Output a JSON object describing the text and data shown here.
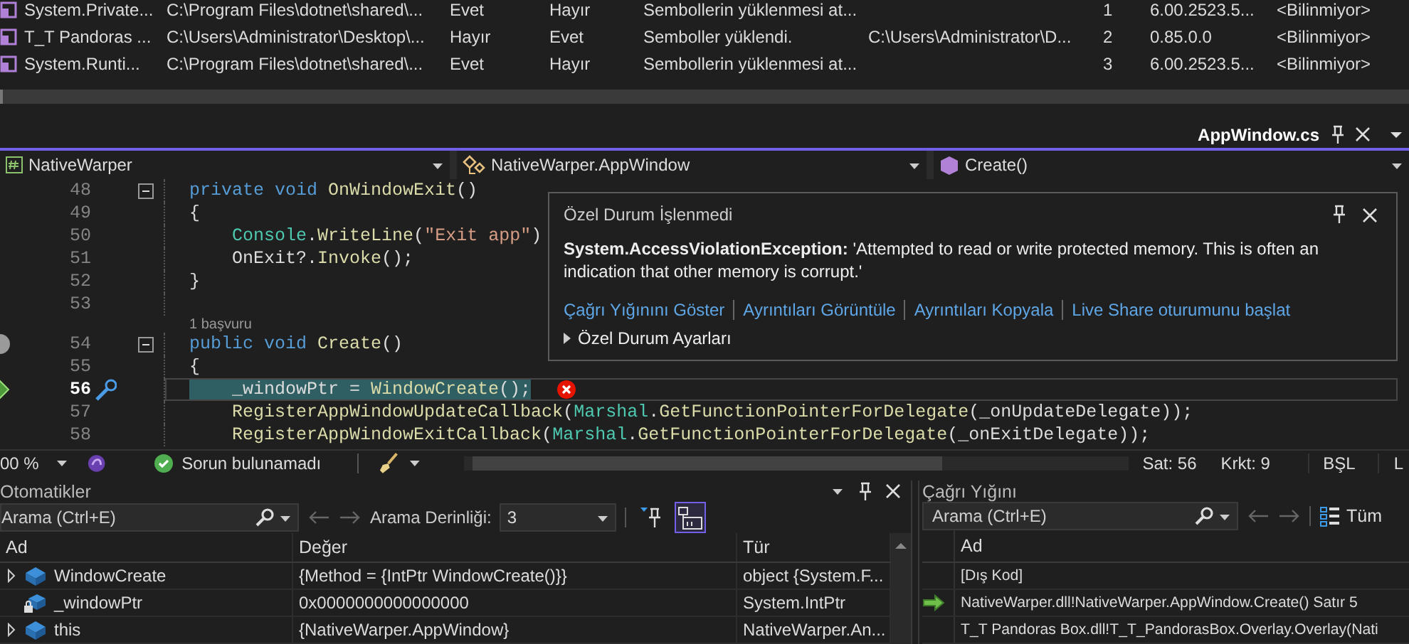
{
  "modules": {
    "rows": [
      {
        "column_1": "System.Private...",
        "column_2": "C:\\Program Files\\dotnet\\shared\\...",
        "column_3": "Evet",
        "column_4": "Hayır",
        "column_5": "Sembollerin yüklenmesi at...",
        "column_7": "1",
        "column_8": "6.00.2523.5...",
        "column_9": "<Bilinmiyor>"
      },
      {
        "column_1": "T_T Pandoras ...",
        "column_2": "C:\\Users\\Administrator\\Desktop\\...",
        "column_3": "Hayır",
        "column_4": "Evet",
        "column_5": "Semboller yüklendi.",
        "column_6": "C:\\Users\\Administrator\\D...",
        "column_7": "2",
        "column_8": "0.85.0.0",
        "column_9": "<Bilinmiyor>"
      },
      {
        "column_1": "System.Runti...",
        "column_2": "C:\\Program Files\\dotnet\\shared\\...",
        "column_3": "Evet",
        "column_4": "Hayır",
        "column_5": "Sembollerin yüklenmesi at...",
        "column_7": "3",
        "column_8": "6.00.2523.5...",
        "column_9": "<Bilinmiyor>"
      }
    ]
  },
  "doc_tabs": [
    {
      "label": "AppWindow.cs",
      "selected": true
    }
  ],
  "navigation": [
    {
      "kind": "project",
      "label": "NativeWarper"
    },
    {
      "kind": "class",
      "label": "NativeWarper.AppWindow"
    },
    {
      "kind": "method",
      "label": "Create()"
    }
  ],
  "editor": {
    "lines": [
      {
        "kind": "code",
        "number": "48",
        "foldable": true,
        "breakpoint": false,
        "current": false,
        "error": false,
        "tokens": [
          {
            "kind": "keyword",
            "text": "private void "
          },
          {
            "kind": "method",
            "text": "OnWindowExit"
          },
          {
            "kind": "plain",
            "text": "()"
          }
        ]
      },
      {
        "kind": "code",
        "number": "49",
        "foldable": false,
        "breakpoint": false,
        "current": false,
        "error": false,
        "tokens": [
          {
            "kind": "plain",
            "text": "{"
          }
        ]
      },
      {
        "kind": "code",
        "number": "50",
        "foldable": false,
        "breakpoint": false,
        "current": false,
        "error": false,
        "tokens": [
          {
            "kind": "type",
            "text": "    Console"
          },
          {
            "kind": "plain",
            "text": "."
          },
          {
            "kind": "method",
            "text": "WriteLine"
          },
          {
            "kind": "plain",
            "text": "("
          },
          {
            "kind": "string",
            "text": "\"Exit app\""
          },
          {
            "kind": "plain",
            "text": ")"
          }
        ]
      },
      {
        "kind": "code",
        "number": "51",
        "foldable": false,
        "breakpoint": false,
        "current": false,
        "error": false,
        "tokens": [
          {
            "kind": "plain",
            "text": "    OnExit?."
          },
          {
            "kind": "method",
            "text": "Invoke"
          },
          {
            "kind": "plain",
            "text": "();"
          }
        ]
      },
      {
        "kind": "code",
        "number": "52",
        "foldable": false,
        "breakpoint": false,
        "current": false,
        "error": false,
        "tokens": [
          {
            "kind": "plain",
            "text": "}"
          }
        ]
      },
      {
        "kind": "code",
        "number": "53",
        "foldable": false,
        "breakpoint": false,
        "current": false,
        "error": false
      },
      {
        "kind": "codelens",
        "text": "1 başvuru"
      },
      {
        "kind": "code",
        "number": "54",
        "foldable": true,
        "breakpoint": true,
        "current": false,
        "error": false,
        "tokens": [
          {
            "kind": "keyword",
            "text": "public void "
          },
          {
            "kind": "method",
            "text": "Create"
          },
          {
            "kind": "plain",
            "text": "()"
          }
        ]
      },
      {
        "kind": "code",
        "number": "55",
        "foldable": false,
        "breakpoint": false,
        "current": false,
        "error": false,
        "tokens": [
          {
            "kind": "plain",
            "text": "{"
          }
        ]
      },
      {
        "kind": "code",
        "number": "56",
        "foldable": false,
        "breakpoint": false,
        "current": true,
        "error": true,
        "tokens": [
          {
            "kind": "plain",
            "text": "    _windowPtr = ",
            "highlighted": true
          },
          {
            "kind": "method",
            "text": "WindowCreate",
            "highlighted": true
          },
          {
            "kind": "plain",
            "text": "();",
            "highlighted": true
          }
        ]
      },
      {
        "kind": "code",
        "number": "57",
        "foldable": false,
        "breakpoint": false,
        "current": false,
        "error": false,
        "tokens": [
          {
            "kind": "method",
            "text": "    RegisterAppWindowUpdateCallback"
          },
          {
            "kind": "plain",
            "text": "("
          },
          {
            "kind": "type",
            "text": "Marshal"
          },
          {
            "kind": "plain",
            "text": "."
          },
          {
            "kind": "method",
            "text": "GetFunctionPointerForDelegate"
          },
          {
            "kind": "plain",
            "text": "(_onUpdateDelegate));"
          }
        ]
      },
      {
        "kind": "code",
        "number": "58",
        "foldable": false,
        "breakpoint": false,
        "current": false,
        "error": false,
        "tokens": [
          {
            "kind": "method",
            "text": "    RegisterAppWindowExitCallback"
          },
          {
            "kind": "plain",
            "text": "("
          },
          {
            "kind": "type",
            "text": "Marshal"
          },
          {
            "kind": "plain",
            "text": "."
          },
          {
            "kind": "method",
            "text": "GetFunctionPointerForDelegate"
          },
          {
            "kind": "plain",
            "text": "(_onExitDelegate));"
          }
        ]
      }
    ]
  },
  "exception": {
    "title": "Özel Durum İşlenmedi",
    "message": "**System.AccessViolationException:** 'Attempted to read or write protected memory. This is often an indication that other memory is corrupt.'",
    "links": [
      "Çağrı Yığınını Göster",
      "Ayrıntıları Görüntüle",
      "Ayrıntıları Kopyala",
      "Live Share oturumunu başlat"
    ],
    "settings": {
      "label": "Özel Durum Ayarları",
      "expanded": false
    }
  },
  "status_bar": {
    "zoom": "00 %",
    "issues": "Sorun bulunamadı",
    "line": "Sat: 56",
    "column": "Krkt: 9",
    "mode": "BŞL",
    "line_ending": "L"
  },
  "autos": {
    "title": "Otomatikler",
    "search": {
      "placeholder": "Arama (Ctrl+E)"
    },
    "depth_label": "Arama Derinliği:",
    "depth": "3",
    "toggles": [
      {
        "selected": false
      },
      {
        "selected": true
      }
    ],
    "columns": [
      "Ad",
      "Değer",
      "Tür"
    ],
    "rows": [
      {
        "kind": "member",
        "expandable": true,
        "name": "WindowCreate",
        "value": "{Method = {IntPtr WindowCreate()}}",
        "type": "object {System.F..."
      },
      {
        "kind": "private-field",
        "expandable": false,
        "name": "_windowPtr",
        "value": "0x0000000000000000",
        "type": "System.IntPtr"
      },
      {
        "kind": "member",
        "expandable": true,
        "name": "this",
        "value": "{NativeWarper.AppWindow}",
        "type": "NativeWarper.An..."
      }
    ]
  },
  "call_stack": {
    "title": "Çağrı Yığını",
    "search": {
      "placeholder": "Arama (Ctrl+E)"
    },
    "all_label": "Tüm",
    "columns": [
      "Ad"
    ],
    "rows": [
      {
        "name": "[Dış Kod]",
        "current": false
      },
      {
        "name": "NativeWarper.dll!NativeWarper.AppWindow.Create() Satır 5",
        "current": true
      },
      {
        "name": "T_T Pandoras Box.dll!T_T_PandorasBox.Overlay.Overlay(Nati",
        "current": false
      }
    ]
  }
}
